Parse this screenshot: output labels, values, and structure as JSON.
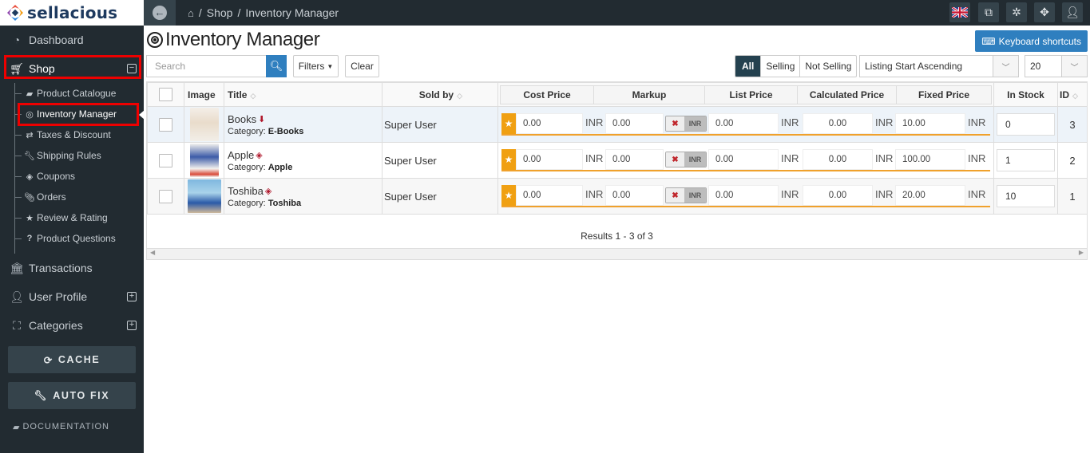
{
  "app": {
    "brand": "sellacious"
  },
  "sidebar": {
    "items": [
      {
        "label": "Dashboard",
        "icon": "dashboard-icon"
      },
      {
        "label": "Shop",
        "icon": "cart-icon",
        "toggle": "⊟"
      },
      {
        "label": "Transactions",
        "icon": "bank-icon"
      },
      {
        "label": "User Profile",
        "icon": "user-icon",
        "toggle": "⊞"
      },
      {
        "label": "Categories",
        "icon": "sitemap-icon",
        "toggle": "⊞"
      }
    ],
    "shop_subitems": [
      {
        "label": "Product Catalogue",
        "icon": "book-icon"
      },
      {
        "label": "Inventory Manager",
        "icon": "target-icon",
        "active": true
      },
      {
        "label": "Taxes & Discount",
        "icon": "exchange-icon"
      },
      {
        "label": "Shipping Rules",
        "icon": "wrench-icon"
      },
      {
        "label": "Coupons",
        "icon": "ticket-icon"
      },
      {
        "label": "Orders",
        "icon": "paperclip-icon"
      },
      {
        "label": "Review & Rating",
        "icon": "star-icon"
      },
      {
        "label": "Product Questions",
        "icon": "question-icon"
      }
    ],
    "cache_button": "CACHE",
    "autofix_button": "AUTO FIX",
    "documentation": "DOCUMENTATION"
  },
  "topbar": {
    "breadcrumb": [
      "Shop",
      "Inventory Manager"
    ],
    "separator": "/",
    "buttons": [
      "language-flag-uk",
      "external-link-icon",
      "joomla-icon",
      "fullscreen-icon",
      "user-icon"
    ]
  },
  "page": {
    "title": "Inventory Manager",
    "keyboard_shortcuts": "Keyboard shortcuts",
    "search_placeholder": "Search",
    "filters_label": "Filters",
    "clear_label": "Clear",
    "segments": [
      "All",
      "Selling",
      "Not Selling"
    ],
    "active_segment": "All",
    "sort_select": "Listing Start Ascending",
    "page_size": "20"
  },
  "table": {
    "headers": {
      "image": "Image",
      "title": "Title",
      "sold_by": "Sold by",
      "cost_price": "Cost Price",
      "markup": "Markup",
      "list_price": "List Price",
      "calculated_price": "Calculated Price",
      "fixed_price": "Fixed Price",
      "in_stock": "In Stock",
      "id": "ID"
    },
    "currency": "INR",
    "category_prefix": "Category:",
    "rows": [
      {
        "title": "Books",
        "type_icon": "download-icon",
        "category": "E-Books",
        "sold_by": "Super User",
        "cost_price": "0.00",
        "markup": "0.00",
        "list_price": "0.00",
        "calculated_price": "0.00",
        "fixed_price": "10.00",
        "in_stock": "0",
        "id": "3"
      },
      {
        "title": "Apple",
        "type_icon": "cube-icon",
        "category": "Apple",
        "sold_by": "Super User",
        "cost_price": "0.00",
        "markup": "0.00",
        "list_price": "0.00",
        "calculated_price": "0.00",
        "fixed_price": "100.00",
        "in_stock": "1",
        "id": "2"
      },
      {
        "title": "Toshiba",
        "type_icon": "cube-icon",
        "category": "Toshiba",
        "sold_by": "Super User",
        "cost_price": "0.00",
        "markup": "0.00",
        "list_price": "0.00",
        "calculated_price": "0.00",
        "fixed_price": "20.00",
        "in_stock": "10",
        "id": "1"
      }
    ],
    "results": "Results 1 - 3 of 3"
  },
  "colors": {
    "accent": "#2f7fbf",
    "sidebar_bg": "#222b31",
    "star": "#f0a012",
    "highlight": "#ee0000"
  }
}
